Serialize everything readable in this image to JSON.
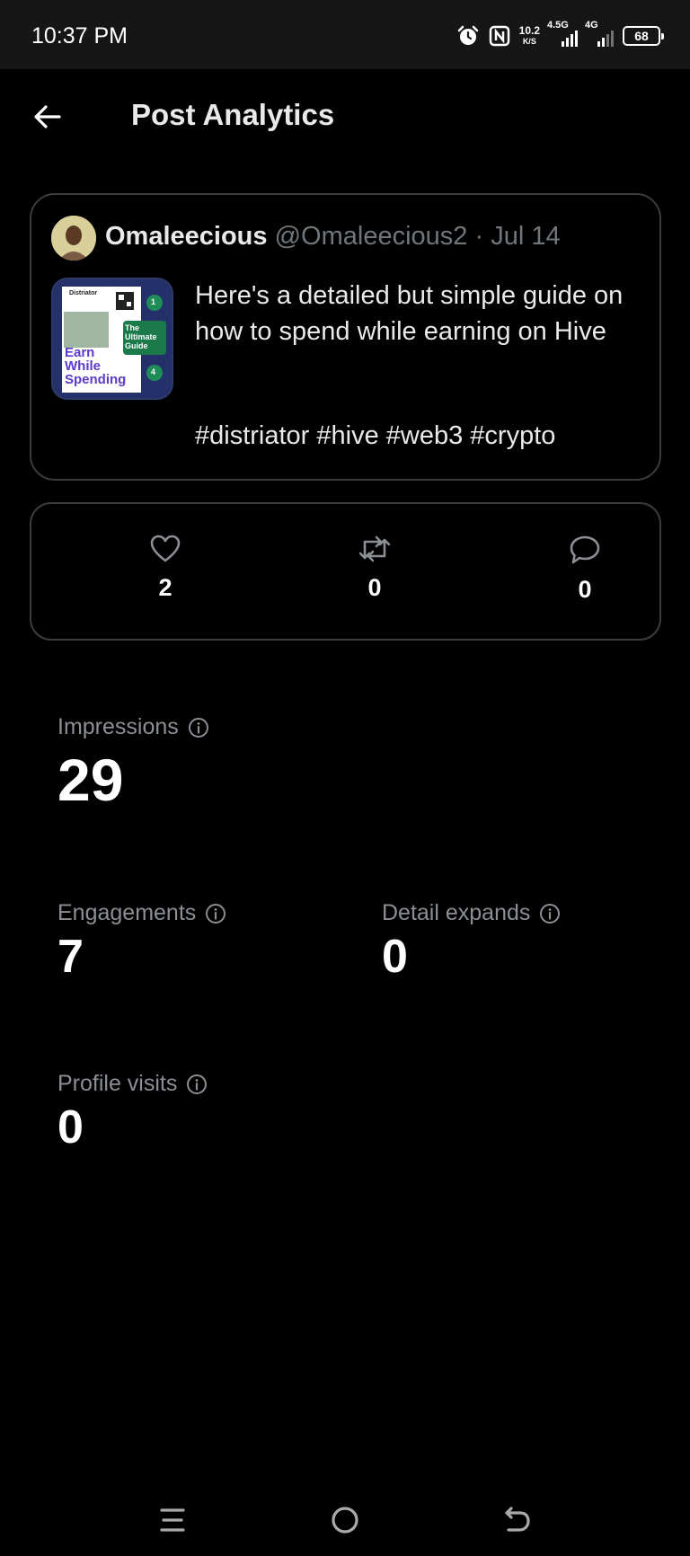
{
  "status_bar": {
    "time": "10:37 PM",
    "net_speed_value": "10.2",
    "net_speed_unit": "K/S",
    "signal1_label": "4.5G",
    "signal2_label": "4G",
    "battery": "68",
    "icons": [
      "alarm-icon",
      "nfc-icon",
      "signal-icon",
      "battery-icon"
    ]
  },
  "header": {
    "title": "Post Analytics",
    "back_icon": "arrow-left-icon"
  },
  "post": {
    "author_name": "Omaleecious",
    "author_handle": "@Omaleecious2",
    "separator": "·",
    "date": "Jul 14",
    "text": "Here's a detailed but simple guide on how to spend while earning on Hive",
    "tags": "#distriator #hive #web3 #crypto",
    "thumbnail": {
      "brand": "Distriator",
      "title_line1": "Earn",
      "title_line2": "While",
      "title_line3": "Spending",
      "badge_line1": "The",
      "badge_line2": "Ultimate",
      "badge_line3": "Guide",
      "step1": "1",
      "step4": "4"
    }
  },
  "engagement": {
    "likes": "2",
    "reposts": "0",
    "replies": "0"
  },
  "metrics": {
    "impressions_label": "Impressions",
    "impressions_value": "29",
    "engagements_label": "Engagements",
    "engagements_value": "7",
    "detail_expands_label": "Detail expands",
    "detail_expands_value": "0",
    "profile_visits_label": "Profile visits",
    "profile_visits_value": "0"
  },
  "nav": {
    "icons": [
      "menu-icon",
      "home-circle-icon",
      "back-nav-icon"
    ]
  },
  "colors": {
    "background": "#000000",
    "text_primary": "#e7e9ea",
    "text_secondary": "#71767b",
    "border": "#3a3d40"
  }
}
